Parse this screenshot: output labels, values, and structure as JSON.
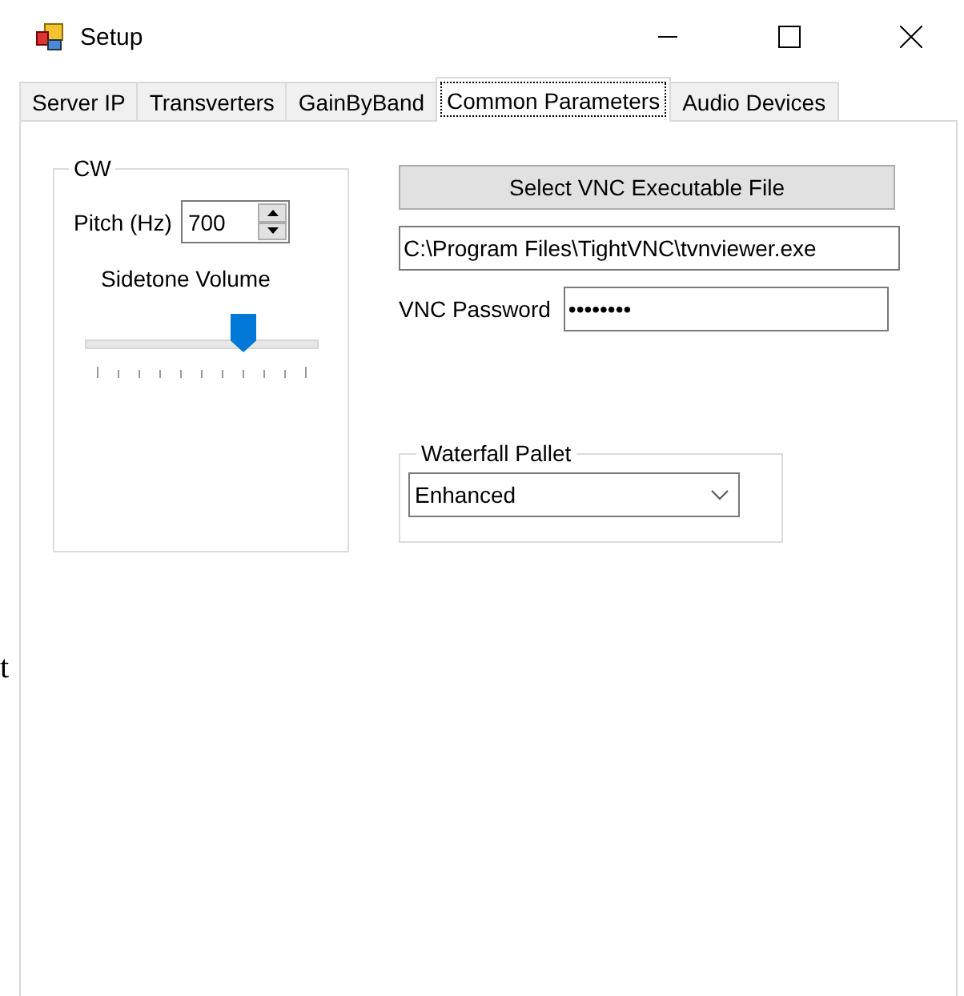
{
  "window": {
    "title": "Setup"
  },
  "tabs": [
    {
      "label": "Server IP",
      "selected": false
    },
    {
      "label": "Transverters",
      "selected": false
    },
    {
      "label": "GainByBand",
      "selected": false
    },
    {
      "label": "Common Parameters",
      "selected": true
    },
    {
      "label": "Audio Devices",
      "selected": false
    }
  ],
  "cw_group": {
    "title": "CW",
    "pitch_label": "Pitch (Hz)",
    "pitch_value": "700",
    "sidetone_label": "Sidetone Volume",
    "sidetone": {
      "level": 0.7
    }
  },
  "vnc": {
    "select_button": "Select VNC Executable File",
    "path": "C:\\Program Files\\TightVNC\\tvnviewer.exe",
    "password_label": "VNC Password",
    "password": "••••••••"
  },
  "waterfall_group": {
    "title": "Waterfall Pallet",
    "value": "Enhanced"
  },
  "background_text": "t"
}
